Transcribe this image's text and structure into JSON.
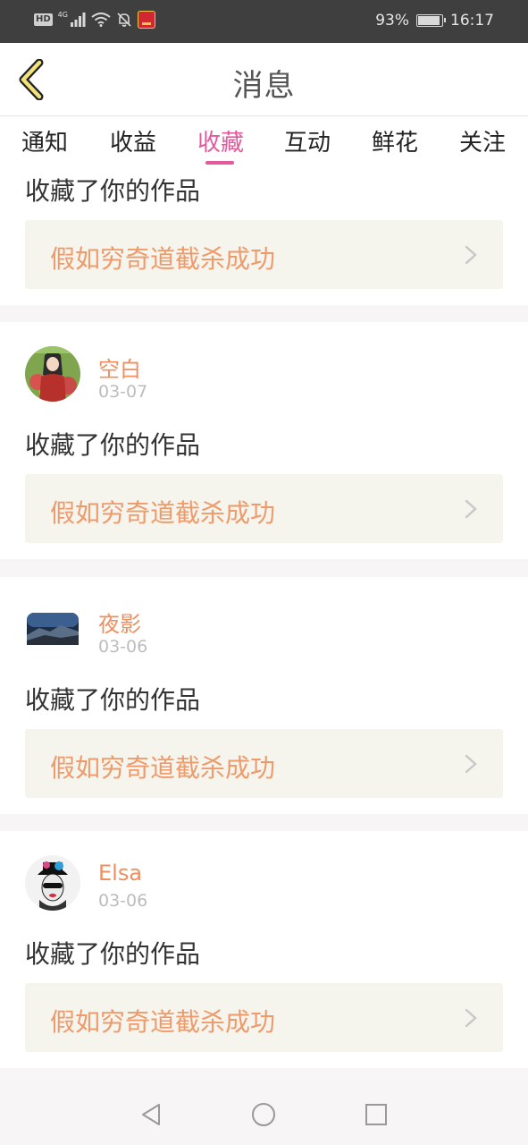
{
  "status_bar": {
    "hd": "HD",
    "network": "4G",
    "battery_percent": "93%",
    "time": "16:17",
    "icons": [
      "signal-icon",
      "wifi-icon",
      "mute-bell-icon",
      "app-notification-icon",
      "battery-charging-icon"
    ]
  },
  "header": {
    "title": "消息",
    "back_icon": "chevron-left-icon"
  },
  "tabs": [
    {
      "label": "通知"
    },
    {
      "label": "收益"
    },
    {
      "label": "收藏",
      "active": true
    },
    {
      "label": "互动"
    },
    {
      "label": "鲜花"
    },
    {
      "label": "关注"
    }
  ],
  "colors": {
    "accent_pink": "#e35a9c",
    "username_orange": "#ef8f5f",
    "work_title_orange": "#ef9a6a",
    "work_box_bg": "#f5f5ee",
    "page_bg": "#f7f5f5"
  },
  "notifications": [
    {
      "partial": true,
      "action": "收藏了你的作品",
      "work_title": "假如穷奇道截杀成功"
    },
    {
      "username": "空白",
      "date": "03-07",
      "avatar": "anime-girl-avatar",
      "action": "收藏了你的作品",
      "work_title": "假如穷奇道截杀成功"
    },
    {
      "username": "夜影",
      "date": "03-06",
      "avatar": "mountain-landscape-avatar",
      "action": "收藏了你的作品",
      "work_title": "假如穷奇道截杀成功"
    },
    {
      "username": "Elsa",
      "date": "03-06",
      "avatar": "girl-with-hat-avatar",
      "action": "收藏了你的作品",
      "work_title": "假如穷奇道截杀成功"
    }
  ],
  "nav_bar": {
    "buttons": [
      "back-triangle-icon",
      "home-circle-icon",
      "recents-square-icon"
    ]
  }
}
